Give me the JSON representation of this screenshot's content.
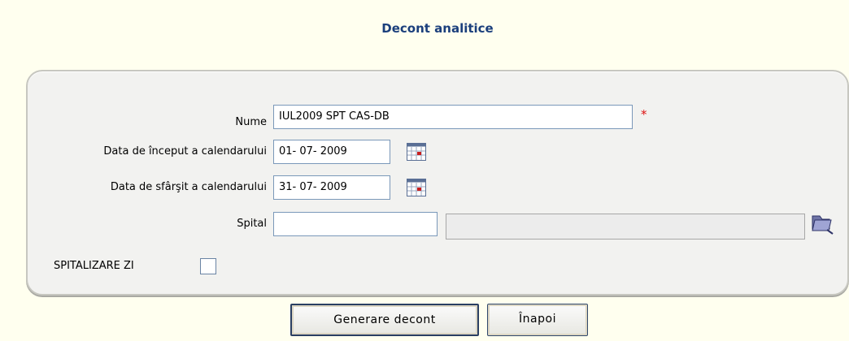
{
  "page": {
    "title": "Decont analitice"
  },
  "form": {
    "nume": {
      "label": "Nume",
      "value": "IUL2009 SPT CAS-DB",
      "required_mark": "*"
    },
    "data_inceput": {
      "label": "Data de început a calendarului",
      "value": "01- 07-  2009"
    },
    "data_sfarsit": {
      "label": "Data de sfârşit a calendarului",
      "value": "31- 07-  2009"
    },
    "spital": {
      "label": "Spital",
      "code_value": "",
      "name_value": ""
    },
    "spitalizare_zi": {
      "label": "SPITALIZARE ZI",
      "checked": false
    }
  },
  "buttons": {
    "generate_label": "Generare decont",
    "back_label": "Înapoi"
  },
  "colors": {
    "title": "#1b3f7c",
    "background": "#ffffef",
    "required": "#d11111"
  }
}
